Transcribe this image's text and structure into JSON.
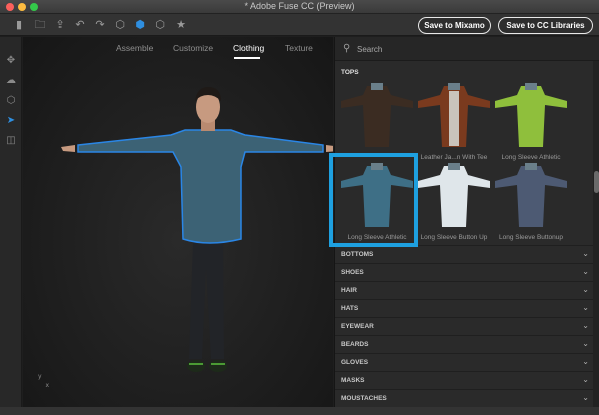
{
  "window": {
    "title": "* Adobe Fuse CC (Preview)"
  },
  "toolbar": {
    "icons": [
      "new-icon",
      "open-icon",
      "export-icon",
      "undo-icon",
      "redo-icon",
      "cube-icon",
      "cube-filled-icon",
      "cube-outline-icon",
      "star-icon"
    ],
    "save_mixamo": "Save to Mixamo",
    "save_libraries": "Save to CC Libraries"
  },
  "rail": {
    "icons": [
      "move-icon",
      "orbit-icon",
      "frame-icon",
      "select-icon",
      "camera-icon"
    ]
  },
  "tabs": [
    {
      "label": "Assemble",
      "active": false
    },
    {
      "label": "Customize",
      "active": false
    },
    {
      "label": "Clothing",
      "active": true
    },
    {
      "label": "Texture",
      "active": false
    }
  ],
  "axis": {
    "y": "y",
    "x": "x"
  },
  "panel": {
    "search_placeholder": "Search",
    "section": "TOPS",
    "items": [
      {
        "label": "",
        "color": "#3b2c22"
      },
      {
        "label": "Leather Ja...n With Tee",
        "color": "#7a3a1e"
      },
      {
        "label": "Long Sleeve Athletic",
        "color": "#8fbf3c"
      },
      {
        "label": "Long Sleeve Athletic",
        "color": "#3e6f86"
      },
      {
        "label": "Long Sleeve Button Up",
        "color": "#dfe6ea"
      },
      {
        "label": "Long Sleeve Buttonup",
        "color": "#4d5a73"
      }
    ],
    "categories": [
      "BOTTOMS",
      "SHOES",
      "HAIR",
      "HATS",
      "EYEWEAR",
      "BEARDS",
      "GLOVES",
      "MASKS",
      "MOUSTACHES"
    ]
  },
  "colors": {
    "accent": "#1ea0e0",
    "shirt": "#3c6275",
    "outline": "#2a86e6"
  }
}
